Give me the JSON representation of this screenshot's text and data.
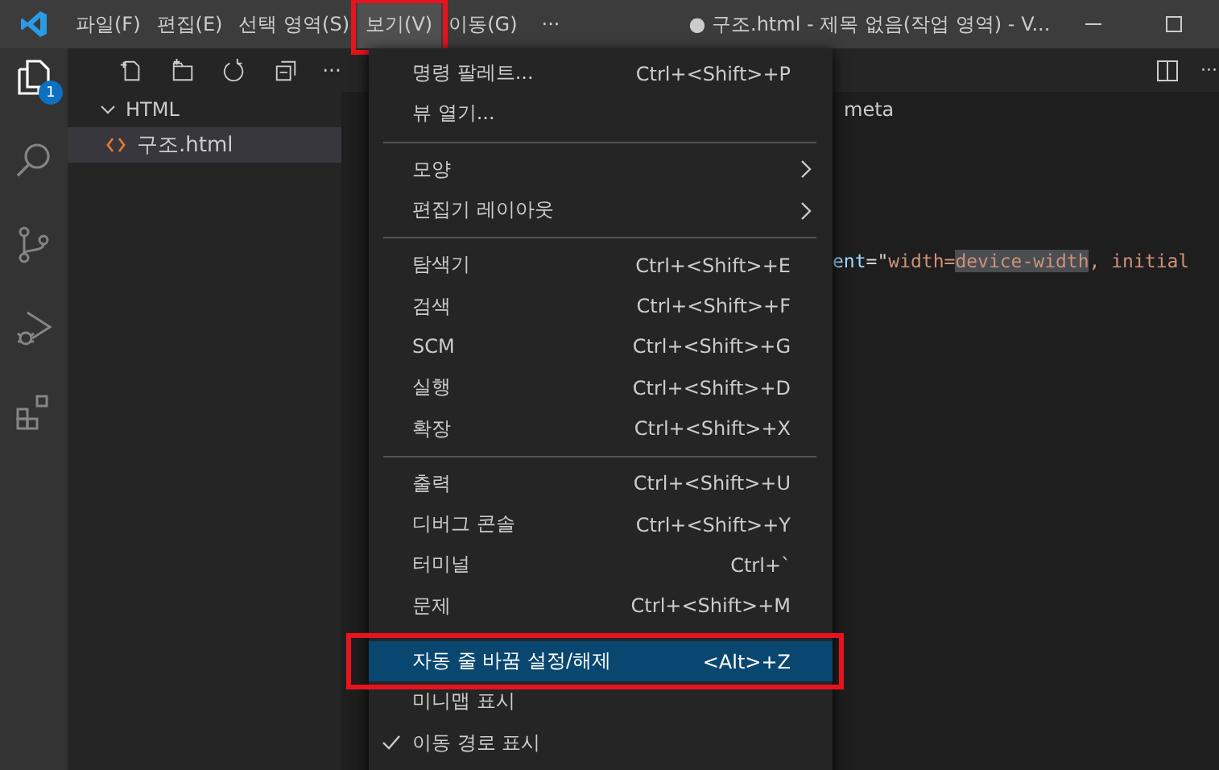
{
  "title_bar": {
    "menus": [
      {
        "label": "파일(F)",
        "selected": false,
        "outlined": false
      },
      {
        "label": "편집(E)",
        "selected": false,
        "outlined": false
      },
      {
        "label": "선택 영역(S)",
        "selected": false,
        "outlined": false
      },
      {
        "label": "보기(V)",
        "selected": true,
        "outlined": true
      },
      {
        "label": "이동(G)",
        "selected": false,
        "outlined": false
      }
    ],
    "overflow": "···",
    "title": "● 구조.html - 제목 없음(작업 영역) - V..."
  },
  "activity_bar": {
    "explorer_badge": "1"
  },
  "sidebar": {
    "overflow": "···",
    "folder": {
      "label": "HTML",
      "expanded": true
    },
    "files": [
      {
        "label": "구조.html",
        "selected": true
      }
    ]
  },
  "editor": {
    "overflow": "···",
    "breadcrumb": "meta",
    "code": [
      {
        "kind": "attr",
        "text": "ent"
      },
      {
        "kind": "punct",
        "text": "=\""
      },
      {
        "kind": "string",
        "text": "width="
      },
      {
        "kind": "highlight",
        "text": "device-width"
      },
      {
        "kind": "string",
        "text": ", initial"
      }
    ]
  },
  "menu": {
    "groups": [
      [
        {
          "kind": "command",
          "label": "명령 팔레트...",
          "shortcut": "Ctrl+<Shift>+P",
          "selected": false,
          "checked": false,
          "outlined": false
        },
        {
          "kind": "command",
          "label": "뷰 열기...",
          "selected": false,
          "checked": false,
          "outlined": false
        }
      ],
      [
        {
          "kind": "submenu",
          "label": "모양",
          "selected": false,
          "checked": false,
          "outlined": false
        },
        {
          "kind": "submenu",
          "label": "편집기 레이아웃",
          "selected": false,
          "checked": false,
          "outlined": false
        }
      ],
      [
        {
          "kind": "command",
          "label": "탐색기",
          "shortcut": "Ctrl+<Shift>+E",
          "selected": false,
          "checked": false,
          "outlined": false
        },
        {
          "kind": "command",
          "label": "검색",
          "shortcut": "Ctrl+<Shift>+F",
          "selected": false,
          "checked": false,
          "outlined": false
        },
        {
          "kind": "command",
          "label": "SCM",
          "shortcut": "Ctrl+<Shift>+G",
          "selected": false,
          "checked": false,
          "outlined": false
        },
        {
          "kind": "command",
          "label": "실행",
          "shortcut": "Ctrl+<Shift>+D",
          "selected": false,
          "checked": false,
          "outlined": false
        },
        {
          "kind": "command",
          "label": "확장",
          "shortcut": "Ctrl+<Shift>+X",
          "selected": false,
          "checked": false,
          "outlined": false
        }
      ],
      [
        {
          "kind": "command",
          "label": "출력",
          "shortcut": "Ctrl+<Shift>+U",
          "selected": false,
          "checked": false,
          "outlined": false
        },
        {
          "kind": "command",
          "label": "디버그 콘솔",
          "shortcut": "Ctrl+<Shift>+Y",
          "selected": false,
          "checked": false,
          "outlined": false
        },
        {
          "kind": "command",
          "label": "터미널",
          "shortcut": "Ctrl+`",
          "selected": false,
          "checked": false,
          "outlined": false
        },
        {
          "kind": "command",
          "label": "문제",
          "shortcut": "Ctrl+<Shift>+M",
          "selected": false,
          "checked": false,
          "outlined": false
        }
      ],
      [
        {
          "kind": "command",
          "label": "자동 줄 바꿈 설정/해제",
          "shortcut": "<Alt>+Z",
          "selected": true,
          "checked": false,
          "outlined": true
        },
        {
          "kind": "command",
          "label": "미니맵 표시",
          "selected": false,
          "checked": false,
          "outlined": false
        },
        {
          "kind": "command",
          "label": "이동 경로 표시",
          "selected": false,
          "checked": true,
          "outlined": false
        }
      ]
    ]
  }
}
